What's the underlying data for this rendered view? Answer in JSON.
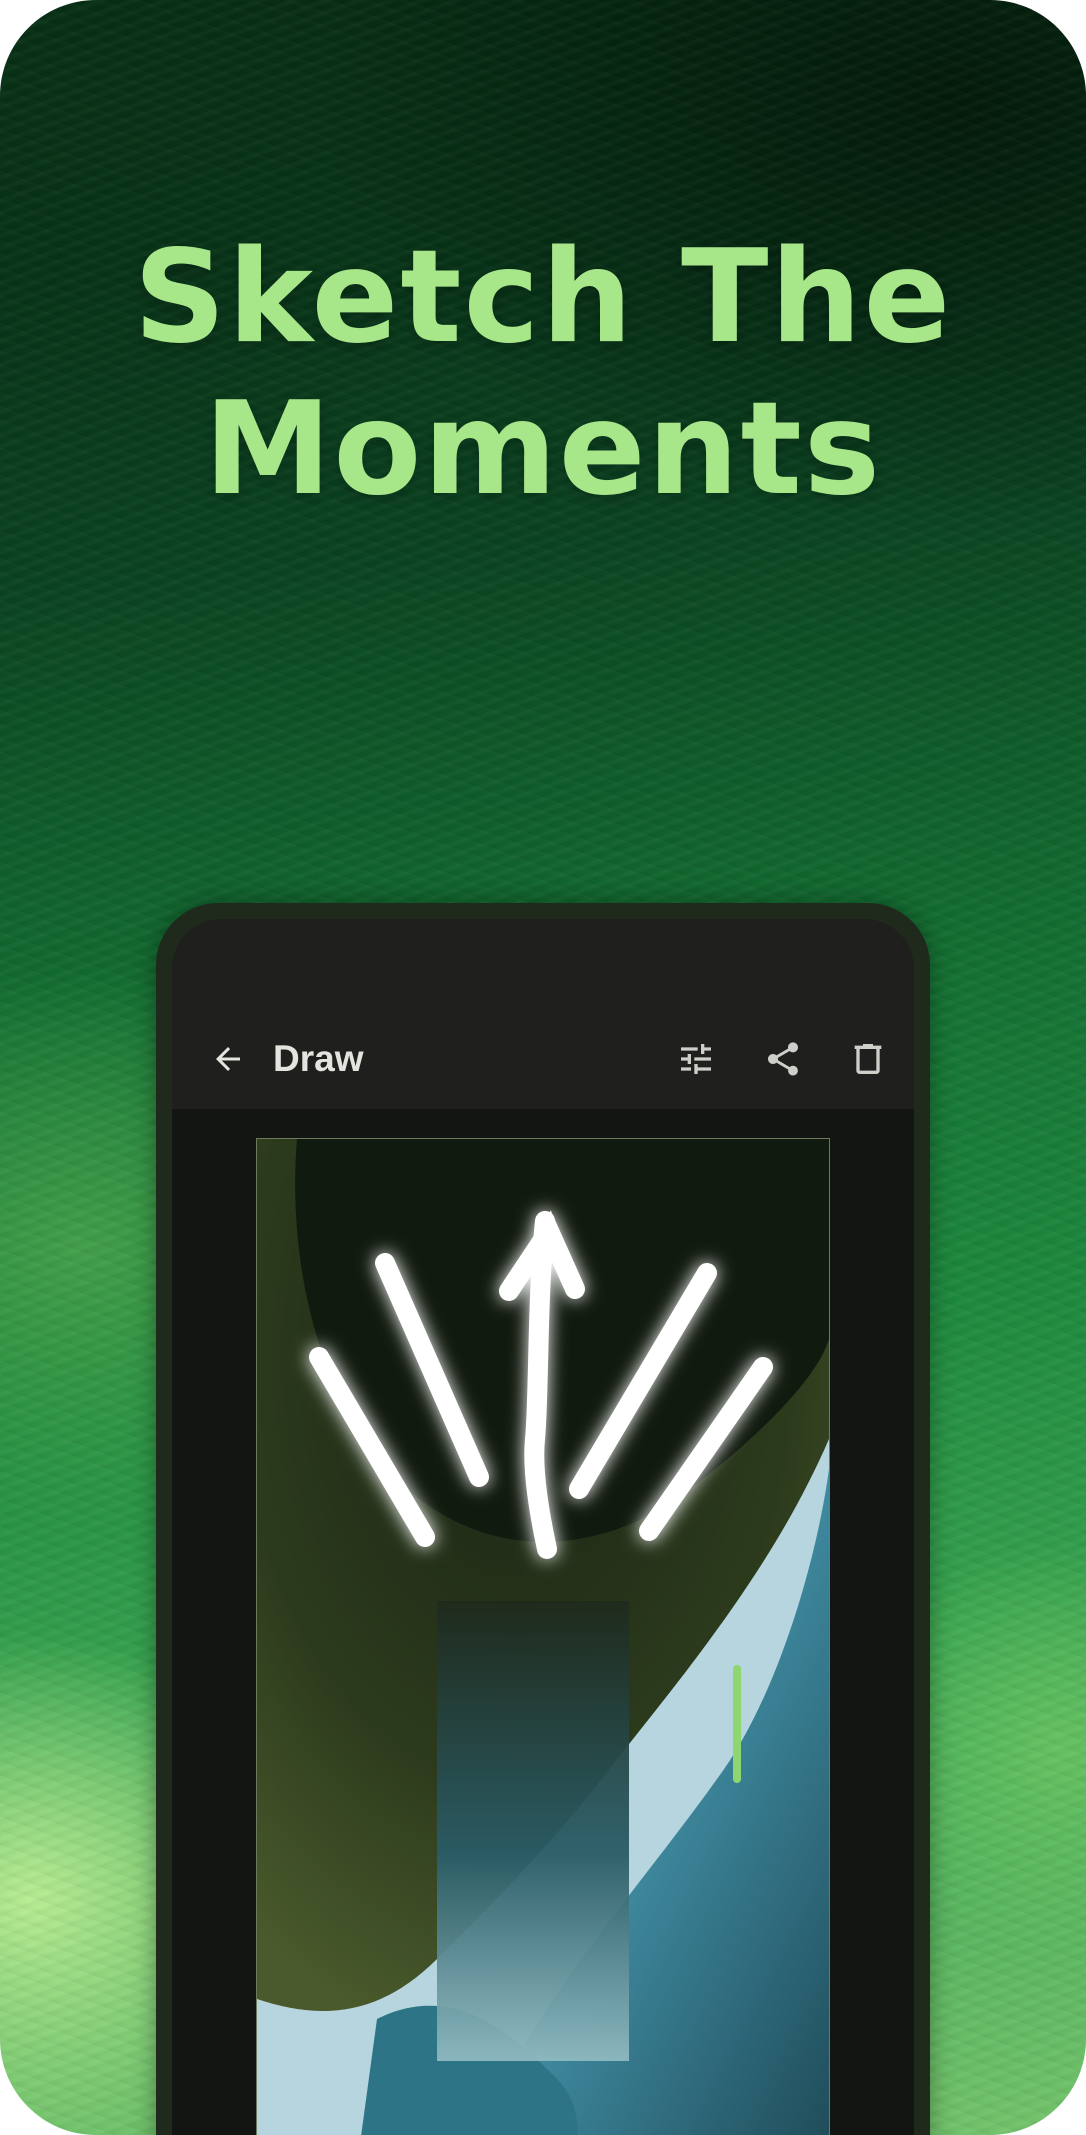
{
  "headline": {
    "line1": "Sketch The",
    "line2": "Moments"
  },
  "app_bar": {
    "title": "Draw",
    "back_icon": "arrow-back-icon",
    "actions": [
      {
        "name": "tune-icon",
        "label": "Adjust"
      },
      {
        "name": "share-icon",
        "label": "Share"
      },
      {
        "name": "delete-icon",
        "label": "Delete"
      }
    ]
  },
  "colors": {
    "headline": "#a8e68a",
    "accent": "#8ed66f",
    "app_bar_bg": "#1f201d",
    "screen_bg": "#131512",
    "stroke_glow": "#c8ff3c"
  },
  "canvas": {
    "stroke_color": "#ffffff",
    "glow_color": "#c8ff3c"
  }
}
